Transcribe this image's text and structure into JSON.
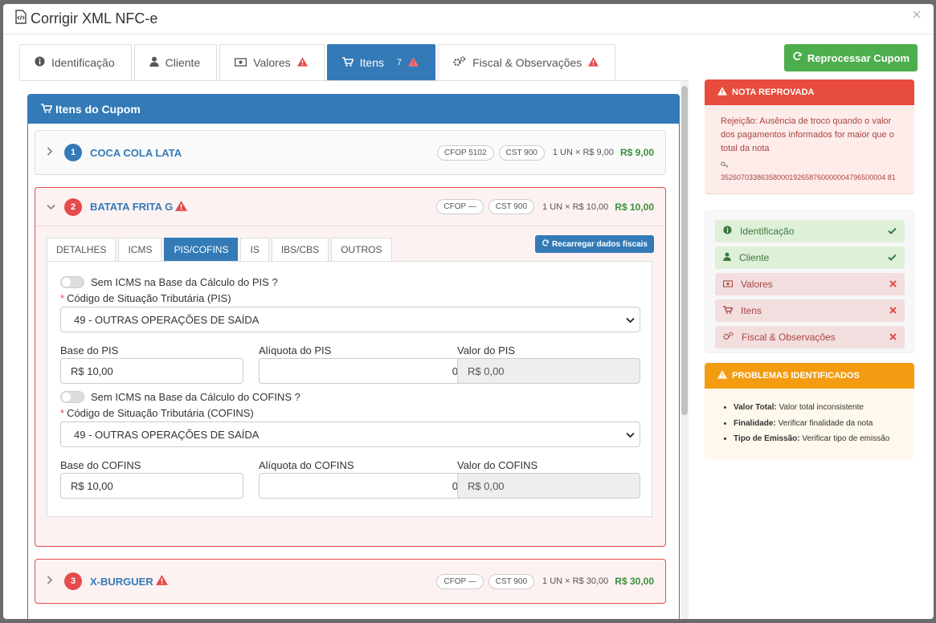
{
  "modal": {
    "title": "Corrigir XML NFC-e"
  },
  "tabs": [
    {
      "label": "Identificação",
      "warn": false
    },
    {
      "label": "Cliente",
      "warn": false
    },
    {
      "label": "Valores",
      "warn": true
    },
    {
      "label": "Itens",
      "count": "7",
      "warn": true,
      "active": true
    },
    {
      "label": "Fiscal & Observações",
      "warn": true
    }
  ],
  "card": {
    "title": "Itens do Cupom"
  },
  "items": [
    {
      "num": "1",
      "name": "COCA COLA LATA",
      "cfop": "CFOP 5102",
      "cst": "CST 900",
      "qty": "1 UN × R$ 9,00",
      "price": "R$ 9,00"
    },
    {
      "num": "2",
      "name": "BATATA FRITA G",
      "cfop": "CFOP —",
      "cst": "CST 900",
      "qty": "1 UN × R$ 10,00",
      "price": "R$ 10,00"
    },
    {
      "num": "3",
      "name": "X-BURGUER",
      "cfop": "CFOP —",
      "cst": "CST 900",
      "qty": "1 UN × R$ 30,00",
      "price": "R$ 30,00"
    }
  ],
  "inner_tabs": [
    "DETALHES",
    "ICMS",
    "PIS/COFINS",
    "IS",
    "IBS/CBS",
    "OUTROS"
  ],
  "reload_label": "Recarregar dados fiscais",
  "pis": {
    "toggle_label": "Sem ICMS na Base da Cálculo do PIS ?",
    "cst_label": "Código de Situação Tributária (PIS)",
    "cst_value": "49 - OUTRAS OPERAÇÕES DE SAÍDA",
    "base_label": "Base do PIS",
    "base_value": "R$ 10,00",
    "aliq_label": "Alíquota do PIS",
    "aliq_value": "0",
    "valor_label": "Valor do PIS",
    "valor_value": "R$ 0,00"
  },
  "cofins": {
    "toggle_label": "Sem ICMS na Base da Cálculo do COFINS ?",
    "cst_label": "Código de Situação Tributária (COFINS)",
    "cst_value": "49 - OUTRAS OPERAÇÕES DE SAÍDA",
    "base_label": "Base do COFINS",
    "base_value": "R$ 10,00",
    "aliq_label": "Alíquota do COFINS",
    "aliq_value": "0",
    "valor_label": "Valor do COFINS",
    "valor_value": "R$ 0,00"
  },
  "reprocess_label": "Reprocessar Cupom",
  "reprovada": {
    "title": "NOTA REPROVADA",
    "text": "Rejeição: Ausência de troco quando o valor dos pagamentos informados for maior que o total da nota",
    "key": "35260703386358000192658760000004796500004 81"
  },
  "status": [
    {
      "label": "Identificação",
      "ok": true
    },
    {
      "label": "Cliente",
      "ok": true
    },
    {
      "label": "Valores",
      "ok": false
    },
    {
      "label": "Itens",
      "ok": false
    },
    {
      "label": "Fiscal & Observações",
      "ok": false
    }
  ],
  "problemas": {
    "title": "PROBLEMAS IDENTIFICADOS",
    "items": [
      {
        "k": "Valor Total:",
        "v": "Valor total inconsistente"
      },
      {
        "k": "Finalidade:",
        "v": "Verificar finalidade da nota"
      },
      {
        "k": "Tipo de Emissão:",
        "v": "Verificar tipo de emissão"
      }
    ]
  },
  "colors": {
    "primary": "#337ab7",
    "danger": "#e74c3c",
    "success": "#4cae4c",
    "warning": "#f39c12"
  }
}
